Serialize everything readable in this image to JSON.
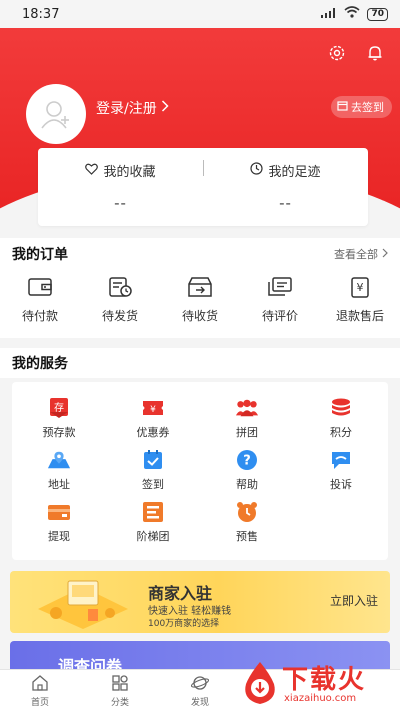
{
  "status_bar": {
    "time": "18:37",
    "battery": "70"
  },
  "header": {
    "login_label": "登录/注册",
    "signin_label": "去签到",
    "favorites_label": "我的收藏",
    "favorites_value": "--",
    "footprints_label": "我的足迹",
    "footprints_value": "--"
  },
  "orders": {
    "title": "我的订单",
    "view_all": "查看全部",
    "items": [
      {
        "label": "待付款",
        "icon": "wallet-icon"
      },
      {
        "label": "待发货",
        "icon": "shipping-pending-icon"
      },
      {
        "label": "待收货",
        "icon": "receive-box-icon"
      },
      {
        "label": "待评价",
        "icon": "review-icon"
      },
      {
        "label": "退款售后",
        "icon": "refund-icon"
      }
    ]
  },
  "services": {
    "title": "我的服务",
    "items": [
      {
        "label": "预存款",
        "icon": "deposit-icon",
        "color": "#e8332d"
      },
      {
        "label": "优惠券",
        "icon": "coupon-icon",
        "color": "#e8332d"
      },
      {
        "label": "拼团",
        "icon": "group-icon",
        "color": "#e8332d"
      },
      {
        "label": "积分",
        "icon": "points-icon",
        "color": "#e8332d"
      },
      {
        "label": "地址",
        "icon": "address-icon",
        "color": "#2f8ef0"
      },
      {
        "label": "签到",
        "icon": "checkin-icon",
        "color": "#2f8ef0"
      },
      {
        "label": "帮助",
        "icon": "help-icon",
        "color": "#2f8ef0"
      },
      {
        "label": "投诉",
        "icon": "complaint-icon",
        "color": "#2f8ef0"
      },
      {
        "label": "提现",
        "icon": "withdraw-icon",
        "color": "#f07a2a"
      },
      {
        "label": "阶梯团",
        "icon": "ladder-group-icon",
        "color": "#f07a2a"
      },
      {
        "label": "预售",
        "icon": "presale-icon",
        "color": "#f07a2a"
      }
    ]
  },
  "merchant": {
    "title": "商家入驻",
    "subtitle": "快速入驻 轻松赚钱",
    "subtitle2": "100万商家的选择",
    "button": "立即入驻"
  },
  "survey": {
    "title": "调查问卷"
  },
  "tabbar": {
    "items": [
      {
        "label": "首页",
        "icon": "home-icon"
      },
      {
        "label": "分类",
        "icon": "category-icon"
      },
      {
        "label": "发现",
        "icon": "discover-icon"
      }
    ]
  },
  "watermark": {
    "text": "下载火",
    "sub": "xiazaihuo.com"
  },
  "colors": {
    "brand_red": "#e8332d",
    "blue": "#2f8ef0",
    "orange": "#f07a2a"
  }
}
